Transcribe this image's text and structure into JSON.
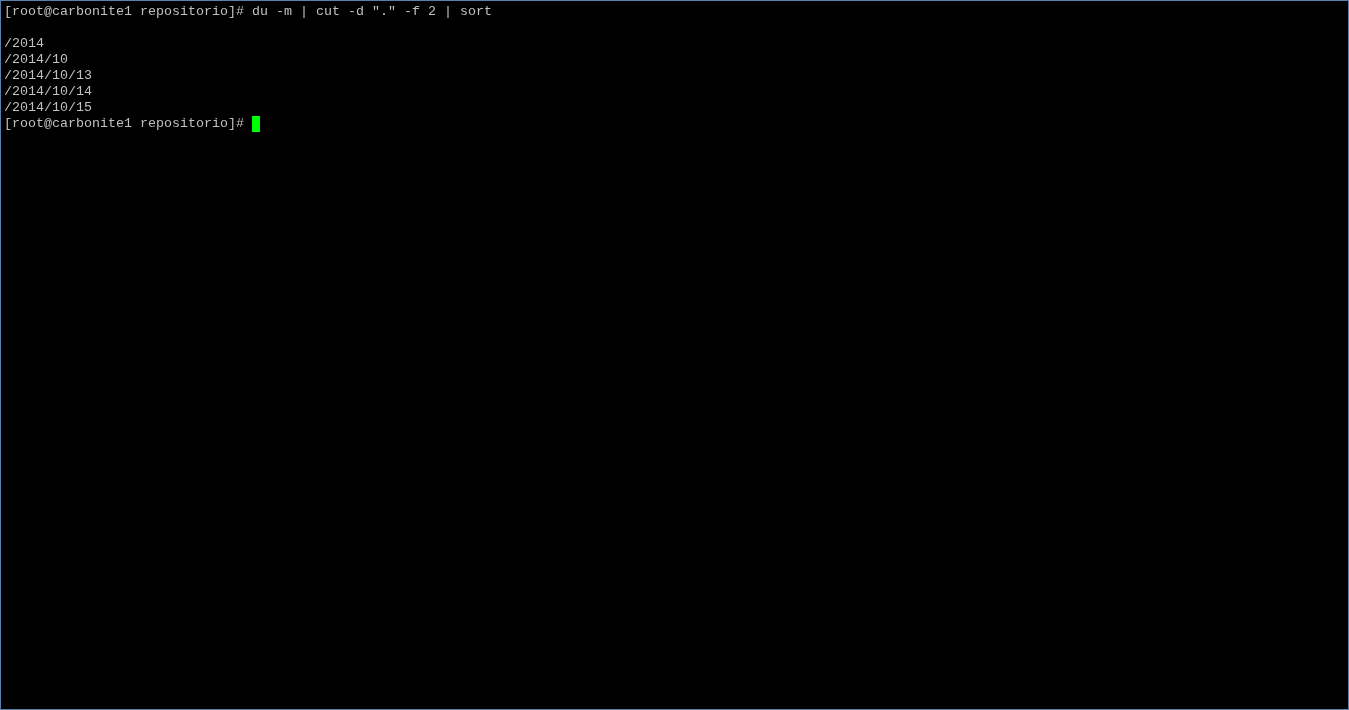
{
  "terminal": {
    "command_line": {
      "prompt": "[root@carbonite1 repositorio]#",
      "command": "du -m | cut -d \".\" -f 2 | sort"
    },
    "output_lines": [
      "/2014",
      "/2014/10",
      "/2014/10/13",
      "/2014/10/14",
      "/2014/10/15"
    ],
    "current_prompt": {
      "prompt": "[root@carbonite1 repositorio]#",
      "cursor_visible": true
    }
  }
}
